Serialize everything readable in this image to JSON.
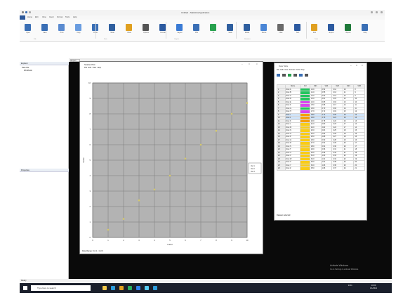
{
  "app": {
    "title": "Untitled - Statistica Application",
    "menus": [
      "File",
      "Home",
      "Edit",
      "View",
      "Insert",
      "Format",
      "Tools",
      "Help"
    ]
  },
  "ribbon": {
    "groups": [
      "File",
      "Data",
      "Graphs",
      "Statistics",
      "Tools"
    ],
    "buttons": [
      {
        "label": "Open",
        "color": "#3a6fb5"
      },
      {
        "label": "Save",
        "color": "#3a6fb5"
      },
      {
        "label": "Print",
        "color": "#5b8bd0"
      },
      {
        "label": "Copy",
        "color": "#6a9de0"
      },
      {
        "label": "Paste",
        "color": "#3a6fb5"
      },
      {
        "label": "Table",
        "color": "#2f5f9f"
      },
      {
        "label": "Chart",
        "color": "#e0a020"
      },
      {
        "label": "Options",
        "color": "#555555"
      },
      {
        "label": "Format",
        "color": "#2c5aa0"
      },
      {
        "label": "Layout",
        "color": "#3a7bd5"
      },
      {
        "label": "Plot",
        "color": "#3a6fb5"
      },
      {
        "label": "Fit",
        "color": "#27a14e"
      },
      {
        "label": "Stats",
        "color": "#2f5f9f"
      },
      {
        "label": "Model",
        "color": "#2f5f9f"
      },
      {
        "label": "Series",
        "color": "#4a86d6"
      },
      {
        "label": "Filter",
        "color": "#6a6a6a"
      },
      {
        "label": "Sort",
        "color": "#2c5aa0"
      },
      {
        "label": "Run",
        "color": "#e0a020"
      },
      {
        "label": "Export",
        "color": "#2c5aa0"
      },
      {
        "label": "Report",
        "color": "#1f7a3a"
      },
      {
        "label": "Help",
        "color": "#3a6fb5"
      }
    ]
  },
  "left_panel": {
    "top_header": "Explorer",
    "tree": [
      "Data File",
      "Workbook"
    ],
    "bottom_header": "Properties"
  },
  "doc_tab": "Project",
  "plot_window": {
    "title": "Scatter Plot",
    "menu": [
      "File",
      "Edit",
      "View",
      "Help"
    ],
    "footer": "Data Range: Col 1 - Col 6",
    "legend": [
      "Var 1",
      "Var 2",
      "Var 3"
    ]
  },
  "chart_data": {
    "type": "scatter",
    "x": [
      1,
      2,
      3,
      4,
      5,
      6,
      7,
      8,
      9,
      10
    ],
    "y": [
      0.5,
      1.2,
      2.4,
      3.1,
      4.0,
      5.1,
      6.0,
      6.9,
      8.0,
      8.7
    ],
    "xlim": [
      0,
      10
    ],
    "ylim": [
      0,
      10
    ],
    "xlabel": "Label",
    "ylabel": "Value",
    "grid": true
  },
  "table_window": {
    "title": "Data Table",
    "menu": [
      "File",
      "Edit",
      "View",
      "Format",
      "Tools",
      "Help"
    ],
    "columns": [
      "",
      "Name",
      "Col",
      "Val1",
      "Val2",
      "Val3",
      "Val4",
      "Val5"
    ],
    "rows": [
      {
        "n": "1",
        "name": "Row A",
        "color": "#22c55e",
        "v": [
          "1.00",
          "0.52",
          "0.12",
          "10",
          "8"
        ]
      },
      {
        "n": "2",
        "name": "Row B",
        "color": "#22c55e",
        "v": [
          "1.10",
          "0.55",
          "0.13",
          "11",
          "9"
        ]
      },
      {
        "n": "3",
        "name": "Row C",
        "color": "#22c55e",
        "v": [
          "1.20",
          "0.60",
          "0.14",
          "12",
          "9"
        ]
      },
      {
        "n": "4",
        "name": "Row D",
        "color": "#22c55e",
        "v": [
          "1.30",
          "0.61",
          "0.15",
          "12",
          "10"
        ]
      },
      {
        "n": "5",
        "name": "Row E",
        "color": "#d946ef",
        "v": [
          "1.40",
          "0.65",
          "0.16",
          "13",
          "10"
        ]
      },
      {
        "n": "6",
        "name": "Row F",
        "color": "#d946ef",
        "v": [
          "1.50",
          "0.68",
          "0.17",
          "14",
          "11"
        ]
      },
      {
        "n": "7",
        "name": "Row G",
        "color": "#22c55e",
        "v": [
          "1.60",
          "0.70",
          "0.18",
          "14",
          "11"
        ]
      },
      {
        "n": "8",
        "name": "Row H",
        "color": "#d946ef",
        "v": [
          "1.70",
          "0.72",
          "0.19",
          "15",
          "12"
        ]
      },
      {
        "n": "9",
        "name": "Row I",
        "color": "#f59e0b",
        "v": [
          "1.80",
          "0.74",
          "0.20",
          "15",
          "12"
        ]
      },
      {
        "n": "10",
        "name": "Row J",
        "color": "#f59e0b",
        "v": [
          "1.90",
          "0.76",
          "0.21",
          "16",
          "13"
        ]
      },
      {
        "n": "11",
        "name": "Row K",
        "color": "#f59e0b",
        "v": [
          "2.00",
          "0.78",
          "0.22",
          "16",
          "13"
        ]
      },
      {
        "n": "12",
        "name": "Row L",
        "color": "#facc15",
        "v": [
          "2.10",
          "0.80",
          "0.23",
          "17",
          "14"
        ]
      },
      {
        "n": "13",
        "name": "Row M",
        "color": "#facc15",
        "v": [
          "2.20",
          "0.82",
          "0.24",
          "17",
          "14"
        ]
      },
      {
        "n": "14",
        "name": "Row N",
        "color": "#facc15",
        "v": [
          "2.30",
          "0.84",
          "0.25",
          "18",
          "15"
        ]
      },
      {
        "n": "15",
        "name": "Row O",
        "color": "#facc15",
        "v": [
          "2.40",
          "0.86",
          "0.26",
          "18",
          "15"
        ]
      },
      {
        "n": "16",
        "name": "Row P",
        "color": "#facc15",
        "v": [
          "2.50",
          "0.88",
          "0.27",
          "19",
          "16"
        ]
      },
      {
        "n": "17",
        "name": "Row Q",
        "color": "#facc15",
        "v": [
          "2.60",
          "0.90",
          "0.28",
          "19",
          "16"
        ]
      },
      {
        "n": "18",
        "name": "Row R",
        "color": "#facc15",
        "v": [
          "2.70",
          "0.92",
          "0.29",
          "20",
          "17"
        ]
      },
      {
        "n": "19",
        "name": "Row S",
        "color": "#facc15",
        "v": [
          "2.80",
          "0.94",
          "0.30",
          "20",
          "17"
        ]
      },
      {
        "n": "20",
        "name": "Row T",
        "color": "#facc15",
        "v": [
          "2.90",
          "0.96",
          "0.31",
          "21",
          "18"
        ]
      },
      {
        "n": "21",
        "name": "Row U",
        "color": "#facc15",
        "v": [
          "3.00",
          "0.98",
          "0.32",
          "21",
          "18"
        ]
      },
      {
        "n": "22",
        "name": "Row V",
        "color": "#facc15",
        "v": [
          "3.10",
          "1.00",
          "0.33",
          "22",
          "19"
        ]
      },
      {
        "n": "23",
        "name": "Row W",
        "color": "#facc15",
        "v": [
          "3.20",
          "1.02",
          "0.34",
          "22",
          "19"
        ]
      },
      {
        "n": "24",
        "name": "Row X",
        "color": "#facc15",
        "v": [
          "3.30",
          "1.04",
          "0.35",
          "23",
          "20"
        ]
      },
      {
        "n": "25",
        "name": "Row Y",
        "color": "#facc15",
        "v": [
          "3.40",
          "1.06",
          "0.36",
          "23",
          "20"
        ]
      },
      {
        "n": "26",
        "name": "Row Z",
        "color": "#facc15",
        "v": [
          "3.50",
          "1.08",
          "0.37",
          "24",
          "21"
        ]
      }
    ],
    "footer": "Dataset selected"
  },
  "status_bar": "Ready",
  "taskbar": {
    "search_placeholder": "Type here to search",
    "apps": [
      {
        "name": "explorer",
        "color": "#f2c94c"
      },
      {
        "name": "edge",
        "color": "#2d9cdb"
      },
      {
        "name": "store",
        "color": "#e0a020"
      },
      {
        "name": "mail",
        "color": "#27ae60"
      },
      {
        "name": "app1",
        "color": "#2f80ed"
      },
      {
        "name": "app2",
        "color": "#56ccf2"
      },
      {
        "name": "app3",
        "color": "#2d9cdb"
      }
    ],
    "tray": "ENG",
    "time": "10:00",
    "date": "1/1/2021"
  },
  "watermark": {
    "line1": "Activate Windows",
    "line2": "Go to Settings to activate Windows."
  }
}
